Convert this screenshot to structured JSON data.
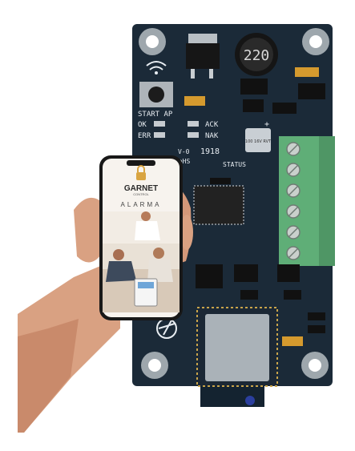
{
  "board": {
    "inductor_label": "220",
    "start_ap_label": "START AP",
    "ok_label": "OK",
    "ack_label": "ACK",
    "err_label": "ERR",
    "nak_label": "NAK",
    "status_label": "STATUS",
    "version_label": "V-0",
    "rohs_label": "RoHS",
    "code_label": "1918",
    "capacitor_label": "100 16V RVT",
    "plus_label": "+"
  },
  "phone": {
    "brand_name": "GARNET",
    "brand_sub": "CONTROL",
    "app_title": "ALARMA"
  },
  "colors": {
    "pcb": "#1b2a38",
    "terminal_green": "#5fae77",
    "brand_gold": "#d9a441"
  }
}
